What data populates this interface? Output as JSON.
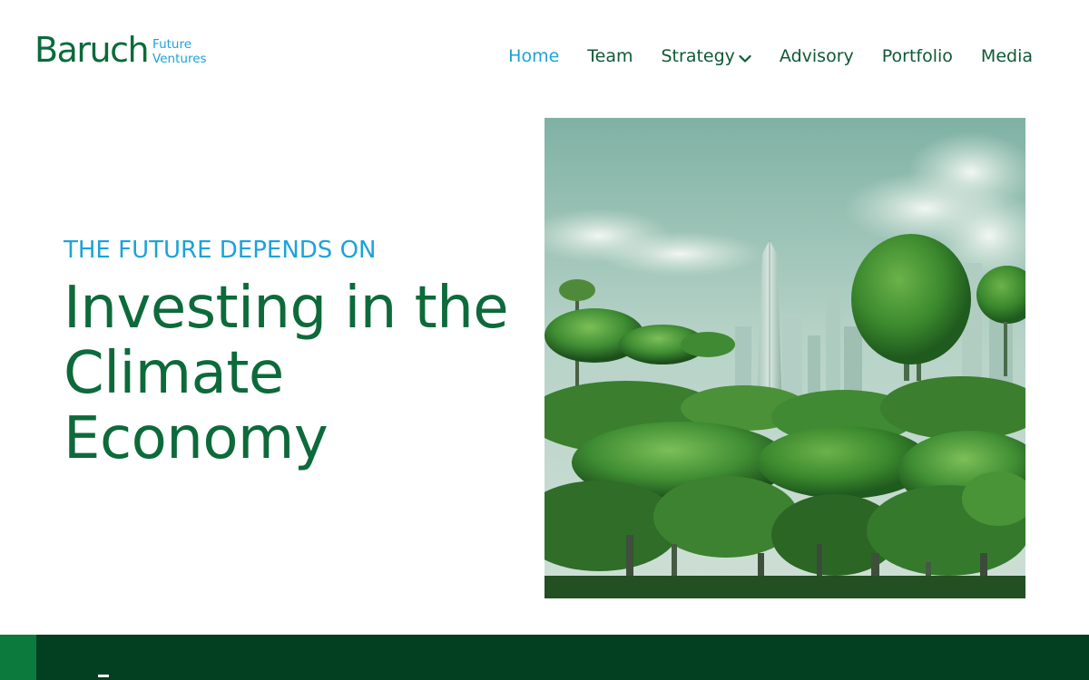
{
  "brand": {
    "name": "Baruch",
    "sub_line1": "Future",
    "sub_line2": "Ventures",
    "primary_color": "#0d6a3a",
    "accent_color": "#1ba3d9"
  },
  "nav": {
    "items": [
      {
        "label": "Home",
        "active": true
      },
      {
        "label": "Team",
        "active": false
      },
      {
        "label": "Strategy",
        "active": false,
        "has_dropdown": true
      },
      {
        "label": "Advisory",
        "active": false
      },
      {
        "label": "Portfolio",
        "active": false
      },
      {
        "label": "Media",
        "active": false
      }
    ],
    "dropdown_icon": "chevron-down-icon"
  },
  "hero": {
    "eyebrow": "THE FUTURE DEPENDS ON",
    "title_line1": "Investing in the",
    "title_line2": "Climate",
    "title_line3": "Economy",
    "image_subject": "green-city-forest-image"
  },
  "band": {
    "background_color": "#033f21",
    "accent_color": "#0c7a3c"
  }
}
